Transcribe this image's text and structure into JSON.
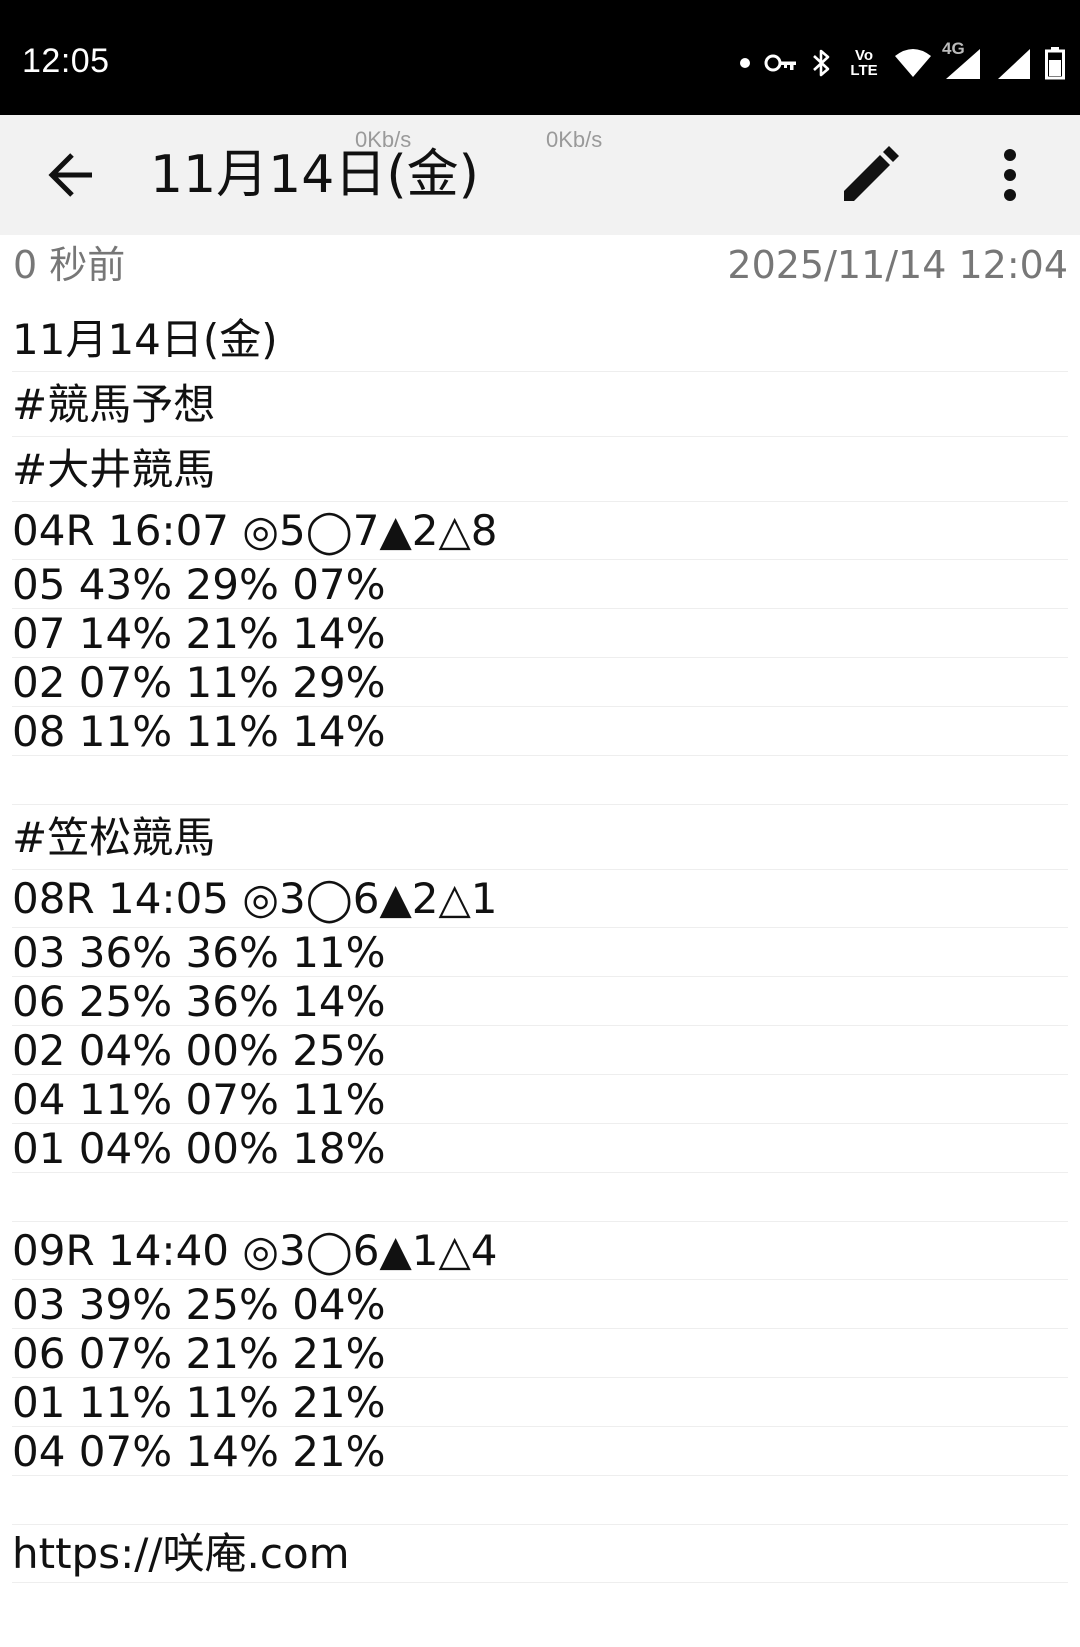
{
  "status_bar": {
    "time": "12:05",
    "net_type": "4G",
    "volte": [
      "Vo",
      "LTE"
    ]
  },
  "app_bar": {
    "title": "11月14日(金)",
    "net_speed_1": "0Kb/s",
    "net_speed_2": "0Kb/s",
    "icons": [
      "back-arrow-icon",
      "pencil-icon",
      "more-vert-icon"
    ]
  },
  "meta": {
    "relative_time": "0 秒前",
    "timestamp": "2025/11/14 12:04"
  },
  "note_lines": [
    "11月14日(金)",
    "#競馬予想",
    "#大井競馬",
    "04R 16:07 ◎5◯7▲2△8",
    "05 43% 29% 07%",
    "07 14% 21% 14%",
    "02 07% 11% 29%",
    "08 11% 11% 14%",
    "",
    "#笠松競馬",
    "08R 14:05 ◎3◯6▲2△1",
    "03 36% 36% 11%",
    "06 25% 36% 14%",
    "02 04% 00% 25%",
    "04 11% 07% 11%",
    "01 04% 00% 18%",
    "",
    "09R 14:40 ◎3◯6▲1△4",
    "03 39% 25% 04%",
    "06 07% 21% 21%",
    "01 11% 11% 21%",
    "04 07% 14% 21%",
    "",
    "https://咲庵.com"
  ]
}
